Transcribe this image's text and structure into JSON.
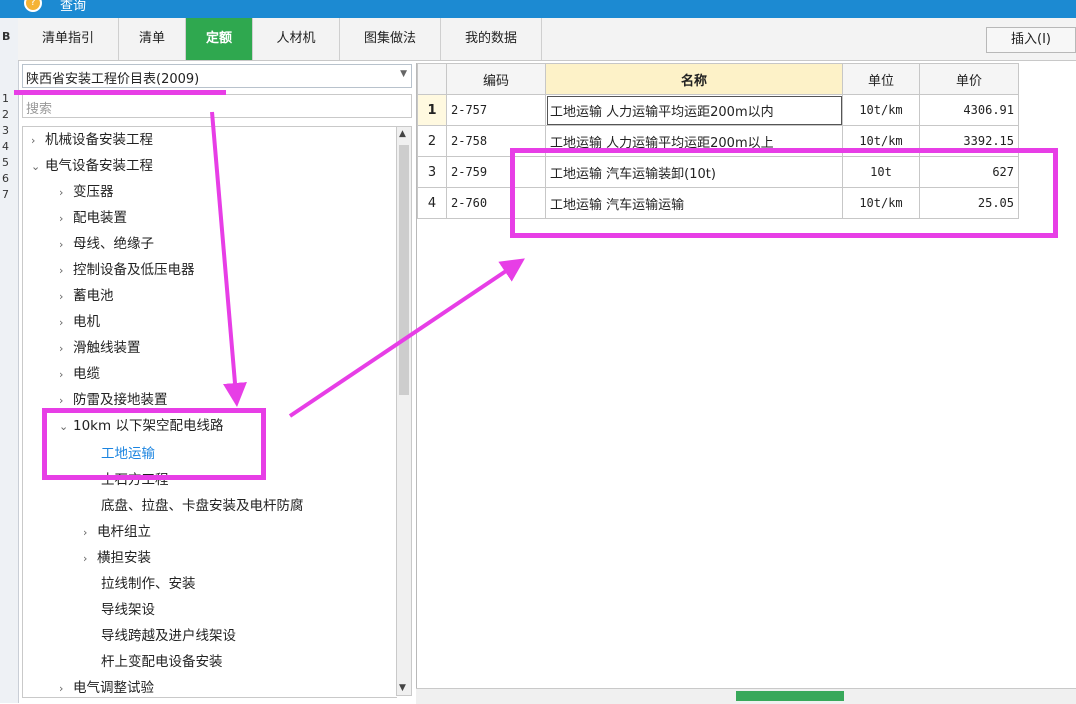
{
  "window": {
    "title": "查询"
  },
  "tabs": [
    {
      "label": "清单指引",
      "active": false
    },
    {
      "label": "清单",
      "active": false
    },
    {
      "label": "定额",
      "active": true
    },
    {
      "label": "人材机",
      "active": false
    },
    {
      "label": "图集做法",
      "active": false
    },
    {
      "label": "我的数据",
      "active": false
    }
  ],
  "insert_button": "插入(I)",
  "library": {
    "selected": "陕西省安装工程价目表(2009)"
  },
  "search": {
    "placeholder": "搜索"
  },
  "tree": [
    {
      "label": "机械设备安装工程",
      "arrow": "›"
    },
    {
      "label": "电气设备安装工程",
      "arrow": "⌄"
    },
    {
      "label": "变压器",
      "arrow": "›"
    },
    {
      "label": "配电装置",
      "arrow": "›"
    },
    {
      "label": "母线、绝缘子",
      "arrow": "›"
    },
    {
      "label": "控制设备及低压电器",
      "arrow": "›"
    },
    {
      "label": "蓄电池",
      "arrow": "›"
    },
    {
      "label": "电机",
      "arrow": "›"
    },
    {
      "label": "滑触线装置",
      "arrow": "›"
    },
    {
      "label": "电缆",
      "arrow": "›"
    },
    {
      "label": "防雷及接地装置",
      "arrow": "›"
    },
    {
      "label": "10km 以下架空配电线路",
      "arrow": "⌄"
    },
    {
      "label": "工地运输",
      "arrow": ""
    },
    {
      "label": "土石方工程",
      "arrow": ""
    },
    {
      "label": "底盘、拉盘、卡盘安装及电杆防腐",
      "arrow": ""
    },
    {
      "label": "电杆组立",
      "arrow": "›"
    },
    {
      "label": "横担安装",
      "arrow": "›"
    },
    {
      "label": "拉线制作、安装",
      "arrow": ""
    },
    {
      "label": "导线架设",
      "arrow": ""
    },
    {
      "label": "导线跨越及进户线架设",
      "arrow": ""
    },
    {
      "label": "杆上变配电设备安装",
      "arrow": ""
    },
    {
      "label": "电气调整试验",
      "arrow": "›"
    }
  ],
  "table": {
    "columns": [
      "编码",
      "名称",
      "单位",
      "单价"
    ],
    "rows": [
      {
        "num": "1",
        "code": "2-757",
        "name": "工地运输 人力运输平均运距200m以内",
        "unit": "10t/km",
        "price": "4306.91"
      },
      {
        "num": "2",
        "code": "2-758",
        "name": "工地运输 人力运输平均运距200m以上",
        "unit": "10t/km",
        "price": "3392.15"
      },
      {
        "num": "3",
        "code": "2-759",
        "name": "工地运输 汽车运输装卸(10t)",
        "unit": "10t",
        "price": "627"
      },
      {
        "num": "4",
        "code": "2-760",
        "name": "工地运输 汽车运输运输",
        "unit": "10t/km",
        "price": "25.05"
      }
    ]
  },
  "left_strip": [
    "B",
    "1",
    "2",
    "3",
    "4",
    "5",
    "6",
    "7"
  ],
  "colors": {
    "active_tab": "#2fa84f",
    "highlight": "#e73ee6",
    "titlebar": "#1c8ad2",
    "selected_node": "#1b84e0"
  }
}
